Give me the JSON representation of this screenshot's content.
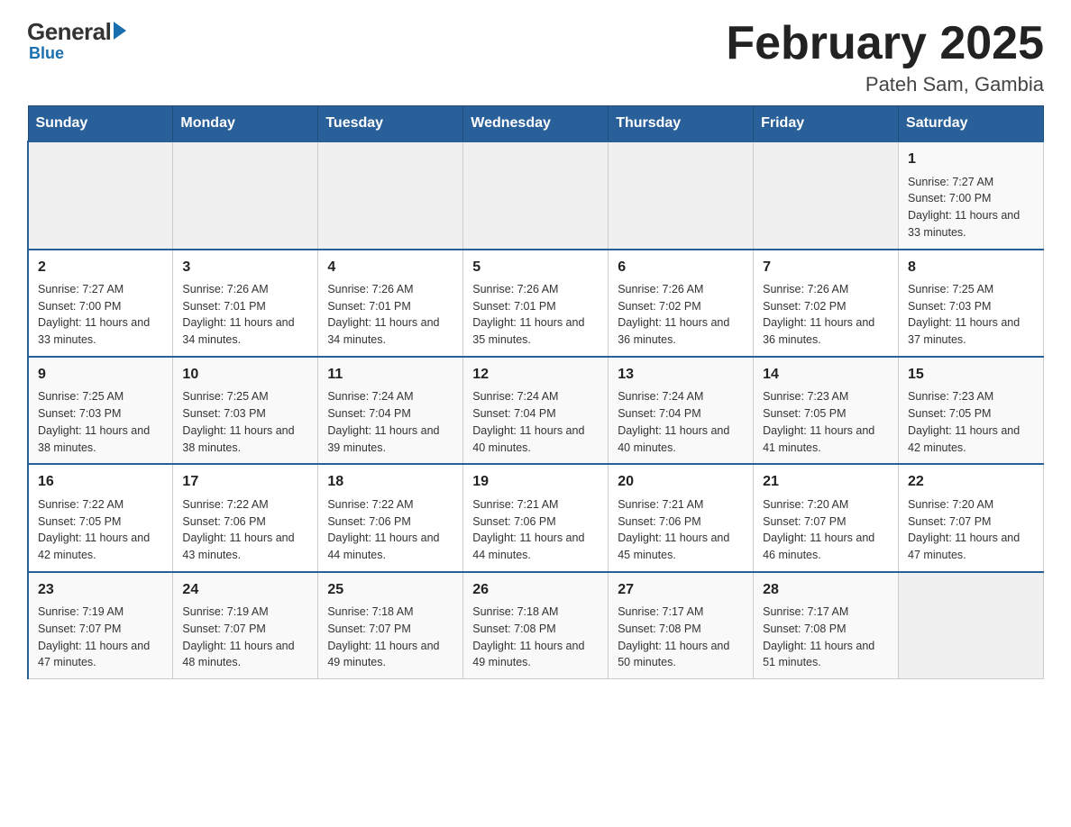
{
  "header": {
    "logo": {
      "general": "General",
      "blue": "Blue"
    },
    "title": "February 2025",
    "location": "Pateh Sam, Gambia"
  },
  "days_of_week": [
    "Sunday",
    "Monday",
    "Tuesday",
    "Wednesday",
    "Thursday",
    "Friday",
    "Saturday"
  ],
  "weeks": [
    [
      {
        "day": "",
        "info": ""
      },
      {
        "day": "",
        "info": ""
      },
      {
        "day": "",
        "info": ""
      },
      {
        "day": "",
        "info": ""
      },
      {
        "day": "",
        "info": ""
      },
      {
        "day": "",
        "info": ""
      },
      {
        "day": "1",
        "info": "Sunrise: 7:27 AM\nSunset: 7:00 PM\nDaylight: 11 hours and 33 minutes."
      }
    ],
    [
      {
        "day": "2",
        "info": "Sunrise: 7:27 AM\nSunset: 7:00 PM\nDaylight: 11 hours and 33 minutes."
      },
      {
        "day": "3",
        "info": "Sunrise: 7:26 AM\nSunset: 7:01 PM\nDaylight: 11 hours and 34 minutes."
      },
      {
        "day": "4",
        "info": "Sunrise: 7:26 AM\nSunset: 7:01 PM\nDaylight: 11 hours and 34 minutes."
      },
      {
        "day": "5",
        "info": "Sunrise: 7:26 AM\nSunset: 7:01 PM\nDaylight: 11 hours and 35 minutes."
      },
      {
        "day": "6",
        "info": "Sunrise: 7:26 AM\nSunset: 7:02 PM\nDaylight: 11 hours and 36 minutes."
      },
      {
        "day": "7",
        "info": "Sunrise: 7:26 AM\nSunset: 7:02 PM\nDaylight: 11 hours and 36 minutes."
      },
      {
        "day": "8",
        "info": "Sunrise: 7:25 AM\nSunset: 7:03 PM\nDaylight: 11 hours and 37 minutes."
      }
    ],
    [
      {
        "day": "9",
        "info": "Sunrise: 7:25 AM\nSunset: 7:03 PM\nDaylight: 11 hours and 38 minutes."
      },
      {
        "day": "10",
        "info": "Sunrise: 7:25 AM\nSunset: 7:03 PM\nDaylight: 11 hours and 38 minutes."
      },
      {
        "day": "11",
        "info": "Sunrise: 7:24 AM\nSunset: 7:04 PM\nDaylight: 11 hours and 39 minutes."
      },
      {
        "day": "12",
        "info": "Sunrise: 7:24 AM\nSunset: 7:04 PM\nDaylight: 11 hours and 40 minutes."
      },
      {
        "day": "13",
        "info": "Sunrise: 7:24 AM\nSunset: 7:04 PM\nDaylight: 11 hours and 40 minutes."
      },
      {
        "day": "14",
        "info": "Sunrise: 7:23 AM\nSunset: 7:05 PM\nDaylight: 11 hours and 41 minutes."
      },
      {
        "day": "15",
        "info": "Sunrise: 7:23 AM\nSunset: 7:05 PM\nDaylight: 11 hours and 42 minutes."
      }
    ],
    [
      {
        "day": "16",
        "info": "Sunrise: 7:22 AM\nSunset: 7:05 PM\nDaylight: 11 hours and 42 minutes."
      },
      {
        "day": "17",
        "info": "Sunrise: 7:22 AM\nSunset: 7:06 PM\nDaylight: 11 hours and 43 minutes."
      },
      {
        "day": "18",
        "info": "Sunrise: 7:22 AM\nSunset: 7:06 PM\nDaylight: 11 hours and 44 minutes."
      },
      {
        "day": "19",
        "info": "Sunrise: 7:21 AM\nSunset: 7:06 PM\nDaylight: 11 hours and 44 minutes."
      },
      {
        "day": "20",
        "info": "Sunrise: 7:21 AM\nSunset: 7:06 PM\nDaylight: 11 hours and 45 minutes."
      },
      {
        "day": "21",
        "info": "Sunrise: 7:20 AM\nSunset: 7:07 PM\nDaylight: 11 hours and 46 minutes."
      },
      {
        "day": "22",
        "info": "Sunrise: 7:20 AM\nSunset: 7:07 PM\nDaylight: 11 hours and 47 minutes."
      }
    ],
    [
      {
        "day": "23",
        "info": "Sunrise: 7:19 AM\nSunset: 7:07 PM\nDaylight: 11 hours and 47 minutes."
      },
      {
        "day": "24",
        "info": "Sunrise: 7:19 AM\nSunset: 7:07 PM\nDaylight: 11 hours and 48 minutes."
      },
      {
        "day": "25",
        "info": "Sunrise: 7:18 AM\nSunset: 7:07 PM\nDaylight: 11 hours and 49 minutes."
      },
      {
        "day": "26",
        "info": "Sunrise: 7:18 AM\nSunset: 7:08 PM\nDaylight: 11 hours and 49 minutes."
      },
      {
        "day": "27",
        "info": "Sunrise: 7:17 AM\nSunset: 7:08 PM\nDaylight: 11 hours and 50 minutes."
      },
      {
        "day": "28",
        "info": "Sunrise: 7:17 AM\nSunset: 7:08 PM\nDaylight: 11 hours and 51 minutes."
      },
      {
        "day": "",
        "info": ""
      }
    ]
  ]
}
